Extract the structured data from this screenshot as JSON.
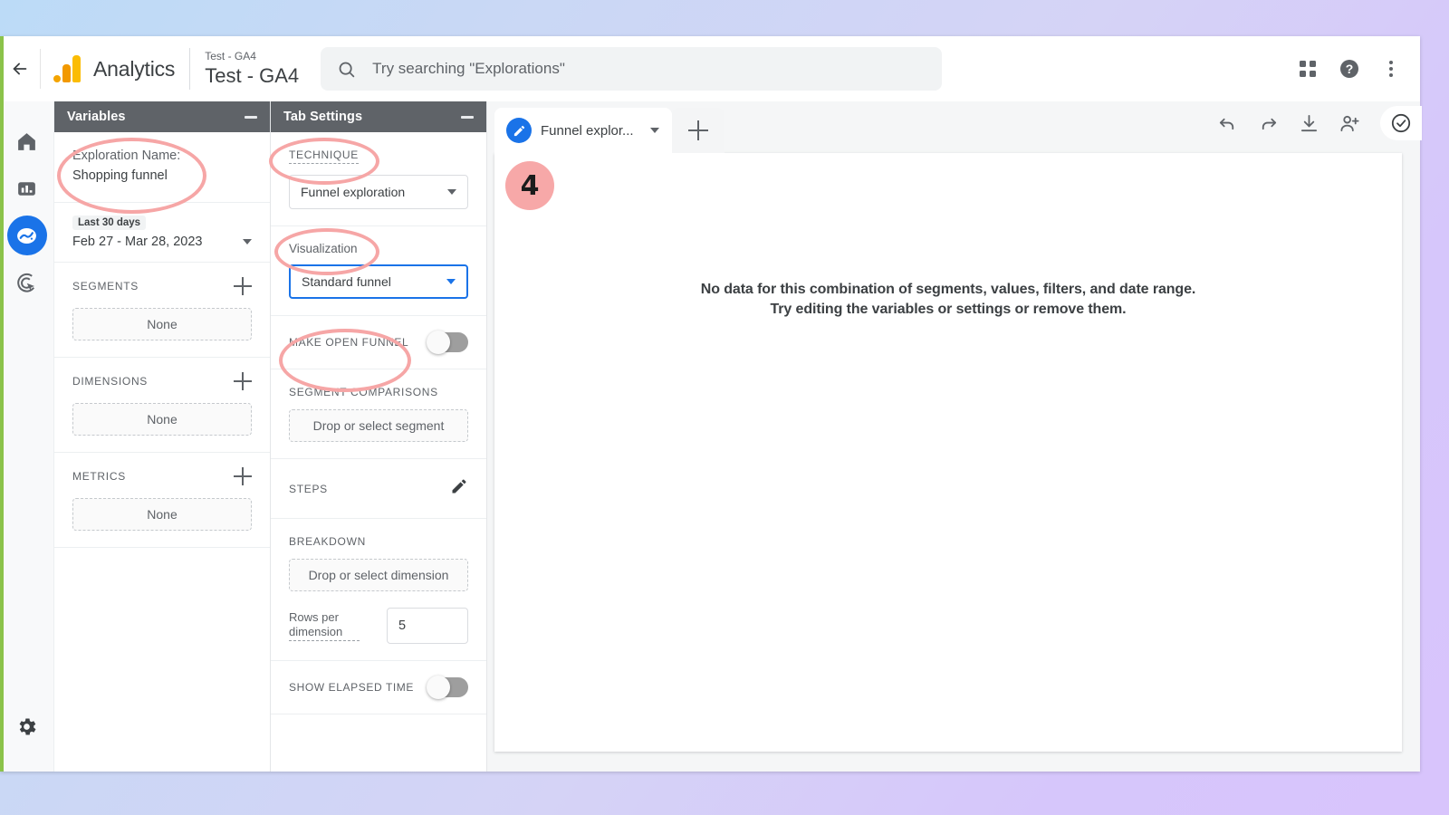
{
  "header": {
    "back_icon": "back-arrow-icon",
    "brand": "Analytics",
    "property_sub": "Test - GA4",
    "property_name": "Test - GA4",
    "search_placeholder": "Try searching \"Explorations\"",
    "search_icon": "search-icon",
    "apps_icon": "apps-grid-icon",
    "help_icon": "help-circle-icon",
    "more_icon": "more-vertical-icon"
  },
  "nav_rail": {
    "items": [
      {
        "name": "home",
        "icon": "home-icon",
        "active": false
      },
      {
        "name": "reports",
        "icon": "bar-chart-icon",
        "active": false
      },
      {
        "name": "explore",
        "icon": "explore-compass-icon",
        "active": true
      },
      {
        "name": "advertising",
        "icon": "advertising-target-icon",
        "active": false
      }
    ],
    "settings": {
      "name": "admin",
      "icon": "gear-icon"
    }
  },
  "variables_panel": {
    "title": "Variables",
    "minimize_icon": "minimize-icon",
    "exploration_label": "Exploration Name:",
    "exploration_value": "Shopping funnel",
    "date_chip": "Last 30 days",
    "date_range": "Feb 27 - Mar 28, 2023",
    "date_caret_icon": "chevron-down-icon",
    "sections": [
      {
        "header": "SEGMENTS",
        "add_icon": "plus-icon",
        "value": "None"
      },
      {
        "header": "DIMENSIONS",
        "add_icon": "plus-icon",
        "value": "None"
      },
      {
        "header": "METRICS",
        "add_icon": "plus-icon",
        "value": "None"
      }
    ]
  },
  "tab_settings_panel": {
    "title": "Tab Settings",
    "minimize_icon": "minimize-icon",
    "technique_label": "TECHNIQUE",
    "technique_value": "Funnel exploration",
    "visualization_label": "Visualization",
    "visualization_value": "Standard funnel",
    "make_open_funnel_label": "MAKE OPEN FUNNEL",
    "make_open_funnel_state": "off",
    "segment_comparisons_label": "SEGMENT COMPARISONS",
    "segment_dropzone": "Drop or select segment",
    "steps_label": "STEPS",
    "steps_edit_icon": "pencil-icon",
    "breakdown_label": "BREAKDOWN",
    "breakdown_dropzone": "Drop or select dimension",
    "rows_per_dimension_label": "Rows per dimension",
    "rows_per_dimension_value": "5",
    "show_elapsed_time_label": "SHOW ELAPSED TIME",
    "show_elapsed_time_state": "off"
  },
  "main": {
    "tab_title": "Funnel explor...",
    "tab_avatar_icon": "pencil-circle-icon",
    "tab_caret_icon": "chevron-down-icon",
    "add_tab_icon": "plus-icon",
    "toolbar": [
      {
        "name": "undo",
        "icon": "undo-icon"
      },
      {
        "name": "redo",
        "icon": "redo-icon"
      },
      {
        "name": "download",
        "icon": "download-icon"
      },
      {
        "name": "share",
        "icon": "person-add-icon"
      },
      {
        "name": "saved-status",
        "icon": "check-circle-icon"
      }
    ],
    "no_data_line1": "No data for this combination of segments, values, filters, and date range.",
    "no_data_line2": "Try editing the variables or settings or remove them."
  },
  "annotations": {
    "step_badge": "4",
    "accent_color": "#f6a6a6",
    "highlights": [
      "exploration-name",
      "technique",
      "visualization",
      "make-open-funnel"
    ]
  },
  "colors": {
    "panel_header": "#5f6368",
    "accent_blue": "#1a73e8",
    "annotation_pink": "#f6a6a6",
    "rail_green": "#8bc34a"
  }
}
